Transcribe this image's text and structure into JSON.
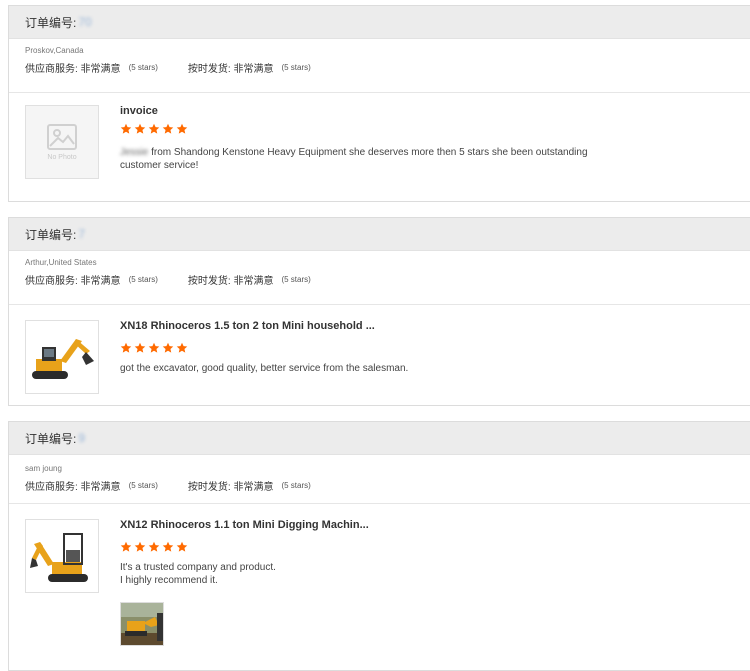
{
  "orders": [
    {
      "order_label": "订单编号:",
      "order_number": "70",
      "buyer_prefix": "",
      "buyer_name": "Proskov,Canada",
      "supplier_service_label": "供应商服务: 非常满意",
      "supplier_service_stars": "(5 stars)",
      "on_time_label": "按时发货: 非常满意",
      "on_time_stars": "(5 stars)",
      "product_title": "invoice",
      "rating": 5,
      "reviewer_blurred": "Jessie",
      "comment_line1": " from Shandong Kenstone  Heavy Equipment she deserves more then 5 stars she been outstanding",
      "comment_line2": "customer service!",
      "no_photo_label": "No Photo"
    },
    {
      "order_label": "订单编号:",
      "order_number": "7",
      "buyer_prefix": "",
      "buyer_name": "Arthur,United States",
      "supplier_service_label": "供应商服务: 非常满意",
      "supplier_service_stars": "(5 stars)",
      "on_time_label": "按时发货: 非常满意",
      "on_time_stars": "(5 stars)",
      "product_title": "XN18 Rhinoceros 1.5 ton 2 ton Mini household ...",
      "rating": 5,
      "comment_line1": "got the excavator, good quality, better service from the salesman."
    },
    {
      "order_label": "订单编号:",
      "order_number": "9",
      "buyer_prefix": "",
      "buyer_name": "sam joung",
      "supplier_service_label": "供应商服务: 非常满意",
      "supplier_service_stars": "(5 stars)",
      "on_time_label": "按时发货: 非常满意",
      "on_time_stars": "(5 stars)",
      "product_title": "XN12 Rhinoceros 1.1 ton Mini Digging Machin...",
      "rating": 5,
      "comment_line1": "It's a trusted company and product.",
      "comment_line2": "I highly recommend it."
    }
  ],
  "colors": {
    "star": "#ff6a00",
    "header_bg": "#ececec",
    "order_number": "#9ab6d8"
  }
}
